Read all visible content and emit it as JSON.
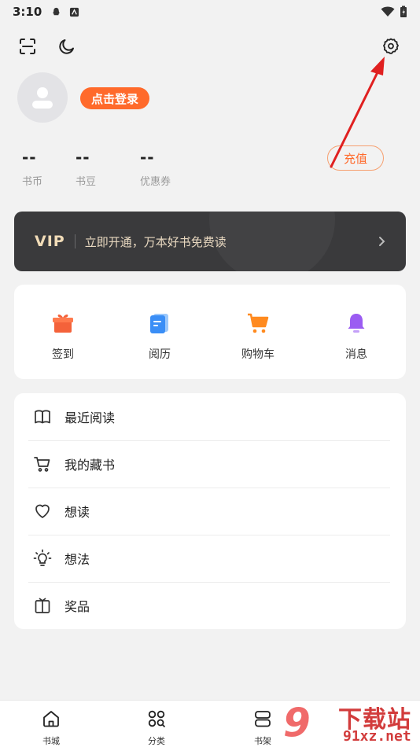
{
  "status_bar": {
    "time": "3:10"
  },
  "profile": {
    "login_label": "点击登录"
  },
  "stats": [
    {
      "value": "--",
      "label": "书币"
    },
    {
      "value": "--",
      "label": "书豆"
    },
    {
      "value": "--",
      "label": "优惠券"
    }
  ],
  "recharge_label": "充值",
  "vip": {
    "badge": "VIP",
    "description": "立即开通，万本好书免费读"
  },
  "quick_actions": [
    {
      "label": "签到",
      "icon": "gift-icon",
      "color": "#f4623a"
    },
    {
      "label": "阅历",
      "icon": "document-icon",
      "color": "#3a8ef6"
    },
    {
      "label": "购物车",
      "icon": "shopping-cart-icon",
      "color": "#ff8a1f"
    },
    {
      "label": "消息",
      "icon": "bell-icon",
      "color": "#9b5cf2"
    }
  ],
  "menu": [
    {
      "label": "最近阅读",
      "icon": "book-icon"
    },
    {
      "label": "我的藏书",
      "icon": "cart-outline-icon"
    },
    {
      "label": "想读",
      "icon": "heart-icon"
    },
    {
      "label": "想法",
      "icon": "lightbulb-icon"
    },
    {
      "label": "奖品",
      "icon": "prize-box-icon"
    }
  ],
  "bottom_nav": [
    {
      "label": "书城",
      "icon": "home-icon"
    },
    {
      "label": "分类",
      "icon": "category-icon"
    },
    {
      "label": "书架",
      "icon": "bookshelf-icon"
    }
  ],
  "watermark": {
    "big": "9",
    "title": "下载站",
    "url": "91xz.net"
  },
  "colors": {
    "accent": "#ff6a2b",
    "vip_bg": "#3a3a3c",
    "annotation_arrow": "#e02020"
  }
}
